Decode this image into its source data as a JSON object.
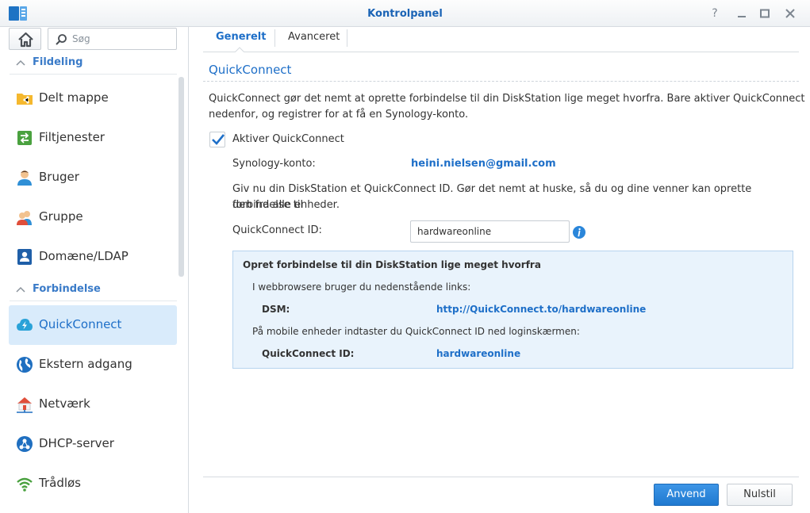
{
  "window": {
    "title": "Kontrolpanel"
  },
  "sidebar": {
    "search_placeholder": "Søg",
    "sections": [
      {
        "label": "Fildeling"
      },
      {
        "label": "Forbindelse"
      }
    ],
    "items": [
      {
        "label": "Delt mappe",
        "icon": "shared-folder-icon"
      },
      {
        "label": "Filtjenester",
        "icon": "file-services-icon"
      },
      {
        "label": "Bruger",
        "icon": "user-icon"
      },
      {
        "label": "Gruppe",
        "icon": "group-icon"
      },
      {
        "label": "Domæne/LDAP",
        "icon": "domain-ldap-icon"
      },
      {
        "label": "QuickConnect",
        "icon": "quickconnect-icon",
        "selected": true
      },
      {
        "label": "Ekstern adgang",
        "icon": "globe-icon"
      },
      {
        "label": "Netværk",
        "icon": "network-icon"
      },
      {
        "label": "DHCP-server",
        "icon": "dhcp-icon"
      },
      {
        "label": "Trådløs",
        "icon": "wifi-icon"
      }
    ]
  },
  "tabs": [
    {
      "label": "Generelt",
      "active": true
    },
    {
      "label": "Avanceret",
      "active": false
    }
  ],
  "main": {
    "title": "QuickConnect",
    "description_line1": "QuickConnect gør det nemt at oprette forbindelse til din DiskStation lige meget hvorfra. Bare aktiver QuickConnect",
    "description_line2": "nedenfor, og registrer for at få en Synology-konto.",
    "enable_label": "Aktiver QuickConnect",
    "enable_checked": true,
    "account_label": "Synology-konto:",
    "account_value": "heini.nielsen@gmail.com",
    "hint_line1": "Giv nu din DiskStation et QuickConnect ID. Gør det nemt at huske, så du og dine venner kan oprette forbindelse til",
    "hint_line2": "den fra alle enheder.",
    "id_label": "QuickConnect ID:",
    "id_value": "hardwareonline"
  },
  "infobox": {
    "title": "Opret forbindelse til din DiskStation lige meget hvorfra",
    "browser_text": "I webbrowsere bruger du nedenstående links:",
    "dsm_label": "DSM:",
    "dsm_link": "http://QuickConnect.to/hardwareonline",
    "mobile_text": "På mobile enheder indtaster du QuickConnect ID ned loginskærmen:",
    "qcid_label": "QuickConnect ID:",
    "qcid_value": "hardwareonline"
  },
  "buttons": {
    "apply": "Anvend",
    "reset": "Nulstil"
  },
  "colors": {
    "accent": "#1e6fc8",
    "selected_bg": "#d9ebfb",
    "primary_button": "#2a86da"
  }
}
